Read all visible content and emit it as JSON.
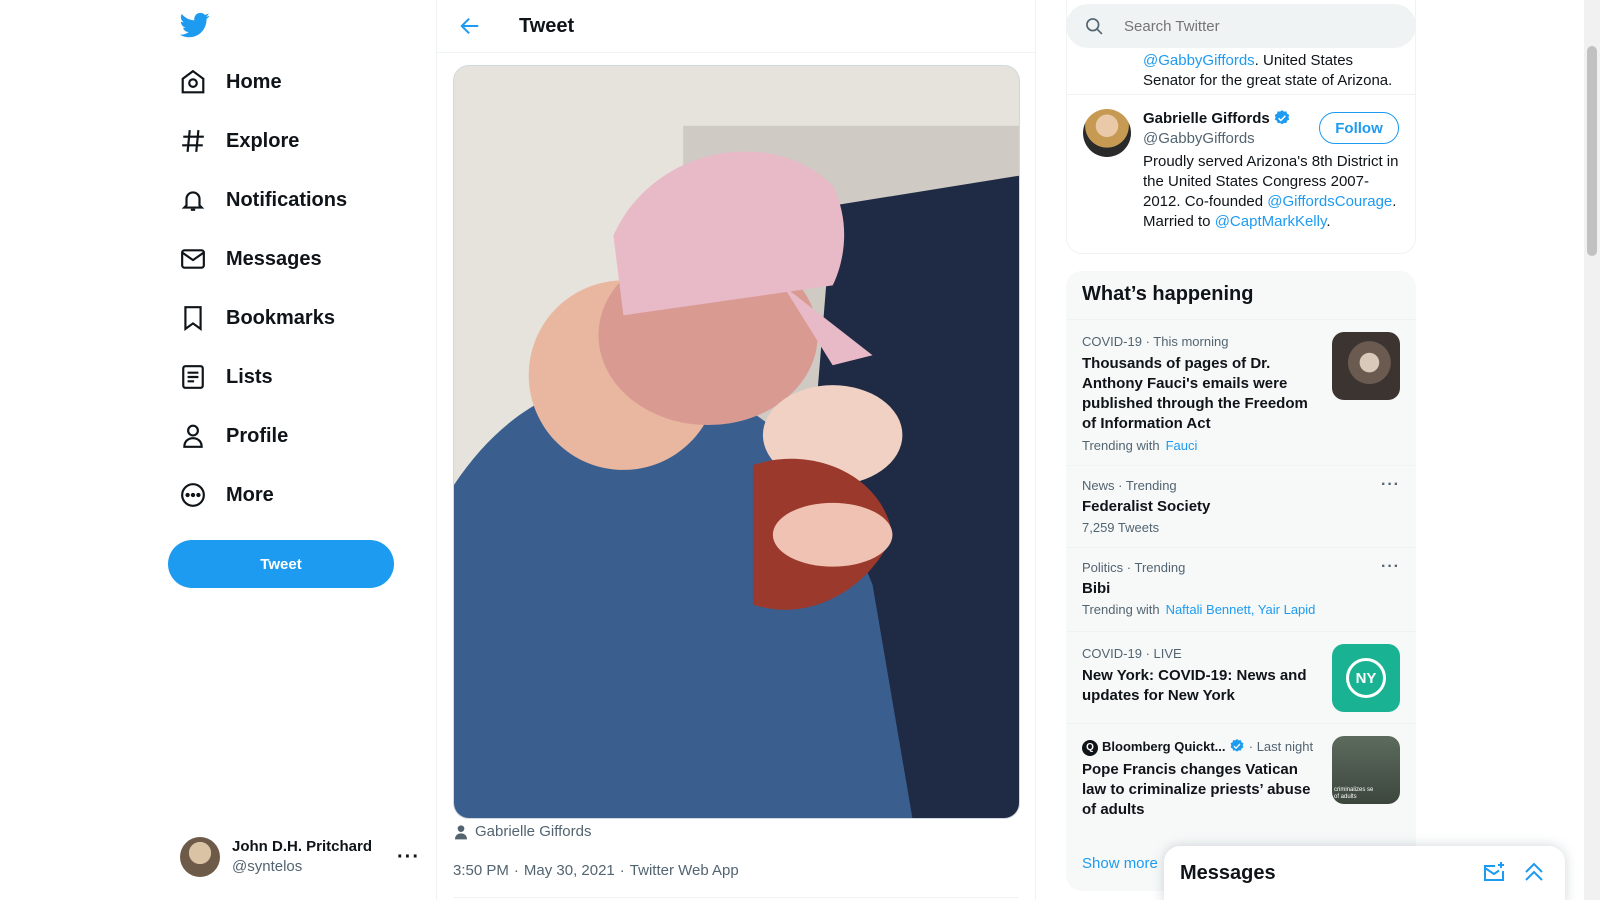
{
  "nav": {
    "items": [
      {
        "label": "Home",
        "icon": "home-icon"
      },
      {
        "label": "Explore",
        "icon": "hashtag-icon"
      },
      {
        "label": "Notifications",
        "icon": "bell-icon"
      },
      {
        "label": "Messages",
        "icon": "envelope-icon"
      },
      {
        "label": "Bookmarks",
        "icon": "bookmark-icon"
      },
      {
        "label": "Lists",
        "icon": "list-icon"
      },
      {
        "label": "Profile",
        "icon": "person-icon"
      },
      {
        "label": "More",
        "icon": "more-circle-icon"
      }
    ],
    "tweet_button": "Tweet",
    "account": {
      "name": "John D.H. Pritchard",
      "handle": "@syntelos",
      "more": "···"
    }
  },
  "center": {
    "header_title": "Tweet",
    "photo_tag": "Gabrielle Giffords",
    "meta": {
      "time": "3:50 PM",
      "date": "May 30, 2021",
      "source": "Twitter Web App"
    }
  },
  "right": {
    "search_placeholder": "Search Twitter",
    "top_bio": {
      "link": "@GabbyGiffords",
      "text": ". United States Senator for the great state of Arizona."
    },
    "who": {
      "name": "Gabrielle Giffords",
      "handle": "@GabbyGiffords",
      "follow": "Follow",
      "bio_1": "Proudly served Arizona's 8th District in the United States Congress 2007-2012. Co-founded ",
      "bio_link_1": "@GiffordsCourage",
      "bio_2": ". Married to ",
      "bio_link_2": "@CaptMarkKelly",
      "bio_3": "."
    },
    "trends_title": "What’s happening",
    "trends": [
      {
        "category": "COVID-19",
        "when": "This morning",
        "title": "Thousands of pages of Dr. Anthony Fauci's emails were published through the Freedom of Information Act",
        "sub_label": "Trending with",
        "sub_links": "Fauci"
      },
      {
        "category": "News · Trending",
        "title": "Federalist Society",
        "count": "7,259 Tweets"
      },
      {
        "category": "Politics · Trending",
        "title": "Bibi",
        "sub_label": "Trending with",
        "sub_links": "Naftali Bennett, Yair Lapid"
      },
      {
        "category": "COVID-19",
        "when": "LIVE",
        "title": "New York: COVID-19: News and updates for New York",
        "thumb_text": "NY"
      },
      {
        "source": "Bloomberg Quickt...",
        "when": "Last night",
        "title": "Pope Francis changes Vatican law to criminalize priests’ abuse of adults",
        "thumb_text": "criminalizes se of adults"
      }
    ],
    "show_more": "Show more"
  },
  "messages_drawer": {
    "title": "Messages"
  },
  "colors": {
    "accent": "#1d9bf0",
    "text": "#0f1419",
    "muted": "#536471"
  }
}
